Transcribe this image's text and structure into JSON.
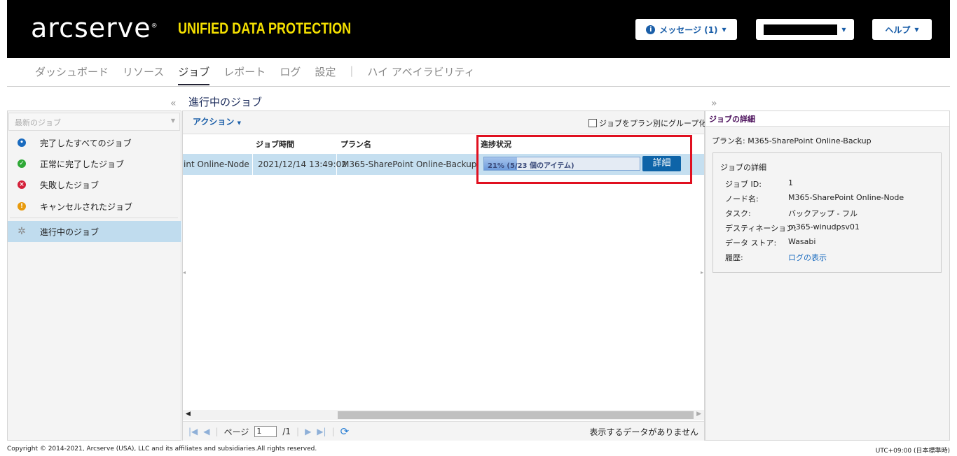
{
  "header": {
    "logo": "arcserve",
    "logo_mark": "®",
    "product": "UNIFIED DATA PROTECTION",
    "messages": "メッセージ (1)",
    "user": "",
    "help": "ヘルプ"
  },
  "nav": [
    "ダッシュボード",
    "リソース",
    "ジョブ",
    "レポート",
    "ログ",
    "設定",
    "|",
    "ハイ アベイラビリティ"
  ],
  "left": {
    "collapse": "«",
    "select_placeholder": "最新のジョブ",
    "items": [
      {
        "label": "完了したすべてのジョブ",
        "color": "#1a6bbf"
      },
      {
        "label": "正常に完了したジョブ",
        "color": "#2ea836"
      },
      {
        "label": "失敗したジョブ",
        "color": "#d4203a"
      },
      {
        "label": "キャンセルされたジョブ",
        "color": "#e89a0c"
      },
      {
        "label": "進行中のジョブ",
        "color": "#888888"
      }
    ]
  },
  "main": {
    "title": "進行中のジョブ",
    "action": "アクション",
    "group_checkbox": "ジョブをプラン別にグループ化",
    "columns": [
      "",
      "ジョブ時間",
      "プラン名",
      "進捗状況"
    ],
    "row": {
      "node": "int Online-Node",
      "time": "2021/12/14 13:49:02",
      "plan": "M365-SharePoint Online-Backup",
      "progress_text": "21% (5/23 個のアイテム)",
      "progress": 0.21,
      "detail": "詳細"
    },
    "pager": {
      "page_label": "ページ",
      "page": "1",
      "total": "/1",
      "empty": "表示するデータがありません"
    }
  },
  "right": {
    "expand": "»",
    "title": "ジョブの詳細",
    "plan_label": "プラン名: M365-SharePoint Online-Backup",
    "box_title": "ジョブの詳細",
    "fields": [
      [
        "ジョブ ID:",
        "1"
      ],
      [
        "ノード名:",
        "M365-SharePoint Online-Node"
      ],
      [
        "タスク:",
        "バックアップ - フル"
      ],
      [
        "デスティネーション:",
        "m365-winudpsv01"
      ],
      [
        "データ ストア:",
        "Wasabi"
      ],
      [
        "履歴:",
        "ログの表示"
      ]
    ]
  },
  "footer": {
    "copyright": "Copyright © 2014-2021, Arcserve (USA), LLC and its affiliates and subsidiaries.All rights reserved.",
    "timezone": "UTC+09:00 (日本標準時)"
  }
}
